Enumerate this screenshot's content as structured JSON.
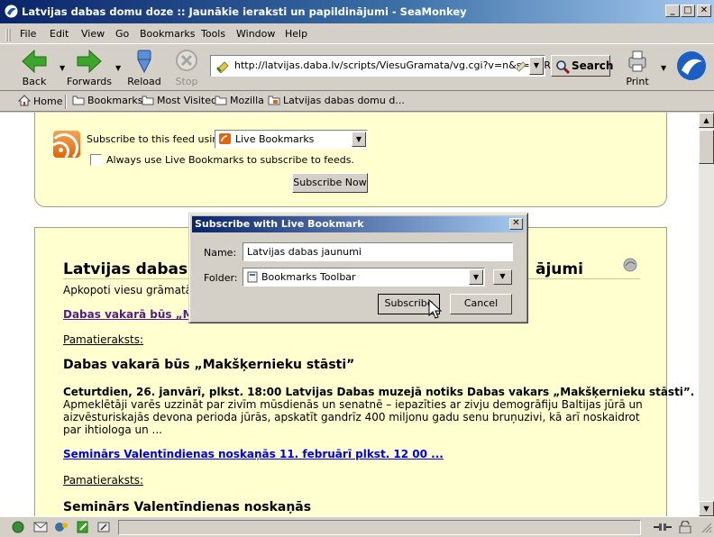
{
  "window": {
    "title": "Latvijas dabas domu doze :: Jaunākie ieraksti un papildinājumi - SeaMonkey",
    "minimize": "_",
    "maximize": "□",
    "close": "✕"
  },
  "menu": [
    "File",
    "Edit",
    "View",
    "Go",
    "Bookmarks",
    "Tools",
    "Window",
    "Help"
  ],
  "nav": {
    "back": "Back",
    "forwards": "Forwards",
    "reload": "Reload",
    "stop": "Stop",
    "url": "http://latvijas.daba.lv/scripts/ViesuGramata/vg.cgi?v=n&s=d&R",
    "search": "Search",
    "print": "Print"
  },
  "bookmarks": {
    "home": "Home",
    "items": [
      "Bookmarks",
      "Most Visited",
      "Mozilla",
      "Latvijas dabas domu d..."
    ]
  },
  "feed": {
    "subscribe_label": "Subscribe to this feed using",
    "reader": "Live Bookmarks",
    "always_label": "Always use Live Bookmarks to subscribe to feeds.",
    "subscribe_now": "Subscribe Now"
  },
  "entries": {
    "heading_left": "Latvijas dabas d",
    "heading_right": "ājumi",
    "subtitle": "Apkopoti viesu grāmatā p",
    "entry1_link": "Dabas vakarā būs „Ma",
    "entry1_sub": "Pamatieraksts:",
    "entry1_title": "Dabas vakarā būs „Makšķernieku stāsti”",
    "entry1_lead": "Ceturtdien, 26. janvārī, plkst. 18:00 Latvijas Dabas muzejā notiks Dabas vakars „Makšķernieku stāsti”.",
    "entry1_body": "Apmeklētāji varēs uzzināt par zivīm mūsdienās un senatnē – iepazīties ar zivju demogrāfiju Baltijas jūrā un aizvēsturiskajās devona perioda jūrās, apskatīt gandrīz 400 miljonu gadu senu bruņuzivi, kā arī noskaidrot par ihtiologa un ...",
    "entry2_link": "Seminārs Valentīndienas noskaņās 11. februārī plkst. 12 00 ...",
    "entry2_sub": "Pamatieraksts:",
    "entry2_title": "Seminārs Valentīndienas noskaņās"
  },
  "dialog": {
    "title": "Subscribe with Live Bookmark",
    "name_label": "Name:",
    "name_value": "Latvijas dabas jaunumi",
    "folder_label": "Folder:",
    "folder_value": "Bookmarks Toolbar",
    "subscribe": "Subscribe",
    "cancel": "Cancel"
  },
  "colors": {
    "titlebar": "#0a246a",
    "card_bg": "#ffffd0",
    "rss": "#e2650b"
  }
}
